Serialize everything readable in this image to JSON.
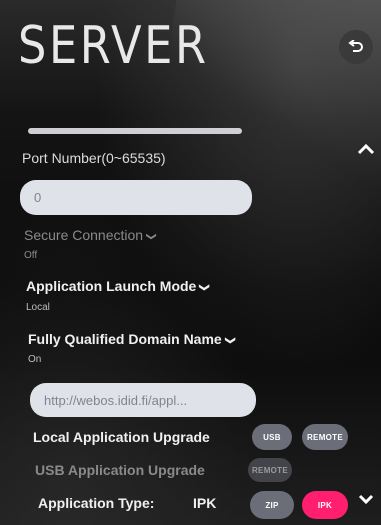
{
  "header": {
    "title": "SERVER",
    "back_icon": "back-arrow-icon"
  },
  "settings": {
    "port": {
      "label": "Port Number(0~65535)",
      "value": "0"
    },
    "secure_connection": {
      "label": "Secure Connection",
      "value": "Off",
      "enabled": false
    },
    "launch_mode": {
      "label": "Application Launch Mode",
      "value": "Local"
    },
    "fqdn": {
      "label": "Fully Qualified Domain Name",
      "value": "On",
      "url": "http://webos.idid.fi/appl..."
    },
    "local_upgrade": {
      "label": "Local Application Upgrade",
      "buttons": [
        "USB",
        "REMOTE"
      ]
    },
    "usb_upgrade": {
      "label": "USB Application Upgrade",
      "button": "REMOTE",
      "enabled": false
    },
    "app_type": {
      "label": "Application Type:",
      "value": "IPK",
      "buttons": [
        "ZIP",
        "IPK"
      ],
      "selected": "IPK"
    }
  },
  "icons": {
    "scroll_up": "chevron-up-icon",
    "scroll_down": "chevron-down-icon",
    "dropdown": "caret-down-icon"
  },
  "colors": {
    "accent": "#ff1f6e",
    "button": "#6b6e78",
    "input": "#dfe2e8"
  }
}
